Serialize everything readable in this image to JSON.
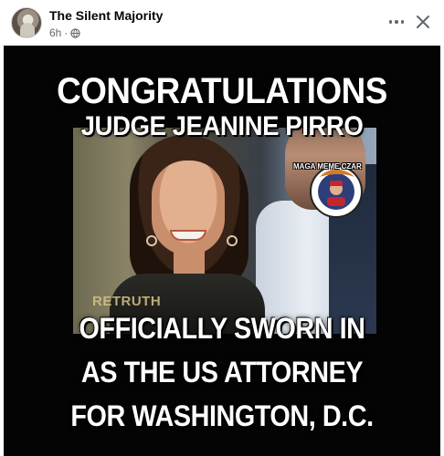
{
  "post": {
    "author": "The Silent Majority",
    "age": "6h",
    "dot": "·"
  },
  "meme": {
    "title_line_1": "CONGRATULATIONS",
    "title_line_2": "JUDGE JEANINE PIRRO",
    "body_line_1": "OFFICIALLY SWORN IN",
    "body_line_2": "AS THE US ATTORNEY",
    "body_line_3": "FOR WASHINGTON, D.C.",
    "badge_caption": "MAGA MEME CZAR",
    "watermark": "RETRUTH"
  },
  "icons": {
    "avatar": "avatar-icon",
    "audience": "globe-icon",
    "more": "more-options-icon",
    "close": "close-icon"
  },
  "colors": {
    "meme_background": "#040404",
    "text": "#ffffff",
    "secondary_text": "#65676b"
  }
}
